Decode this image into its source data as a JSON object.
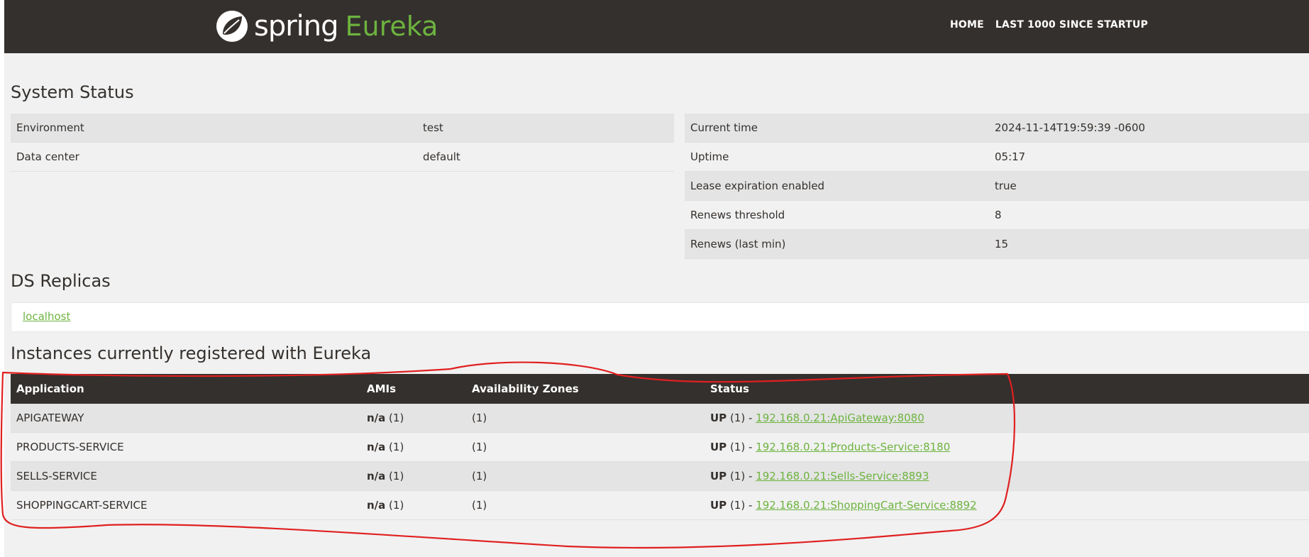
{
  "brand": {
    "spring": "spring",
    "eureka": "Eureka"
  },
  "nav": {
    "home": "HOME",
    "last1000": "LAST 1000 SINCE STARTUP"
  },
  "system_status": {
    "title": "System Status",
    "left": [
      {
        "label": "Environment",
        "value": "test"
      },
      {
        "label": "Data center",
        "value": "default"
      }
    ],
    "right": [
      {
        "label": "Current time",
        "value": "2024-11-14T19:59:39 -0600"
      },
      {
        "label": "Uptime",
        "value": "05:17"
      },
      {
        "label": "Lease expiration enabled",
        "value": "true"
      },
      {
        "label": "Renews threshold",
        "value": "8"
      },
      {
        "label": "Renews (last min)",
        "value": "15"
      }
    ]
  },
  "ds_replicas": {
    "title": "DS Replicas",
    "link": "localhost"
  },
  "instances": {
    "title": "Instances currently registered with Eureka",
    "headers": {
      "application": "Application",
      "amis": "AMIs",
      "zones": "Availability Zones",
      "status": "Status"
    },
    "rows": [
      {
        "application": "APIGATEWAY",
        "amis_bold": "n/a",
        "amis_count": " (1)",
        "zones": "(1)",
        "status_bold": "UP",
        "status_count": " (1) - ",
        "link": "192.168.0.21:ApiGateway:8080"
      },
      {
        "application": "PRODUCTS-SERVICE",
        "amis_bold": "n/a",
        "amis_count": " (1)",
        "zones": "(1)",
        "status_bold": "UP",
        "status_count": " (1) - ",
        "link": "192.168.0.21:Products-Service:8180"
      },
      {
        "application": "SELLS-SERVICE",
        "amis_bold": "n/a",
        "amis_count": " (1)",
        "zones": "(1)",
        "status_bold": "UP",
        "status_count": " (1) - ",
        "link": "192.168.0.21:Sells-Service:8893"
      },
      {
        "application": "SHOPPINGCART-SERVICE",
        "amis_bold": "n/a",
        "amis_count": " (1)",
        "zones": "(1)",
        "status_bold": "UP",
        "status_count": " (1) - ",
        "link": "192.168.0.21:ShoppingCart-Service:8892"
      }
    ]
  },
  "colors": {
    "header_bg": "#34302d",
    "accent_green": "#6db33f",
    "annotation_red": "#e02020"
  }
}
